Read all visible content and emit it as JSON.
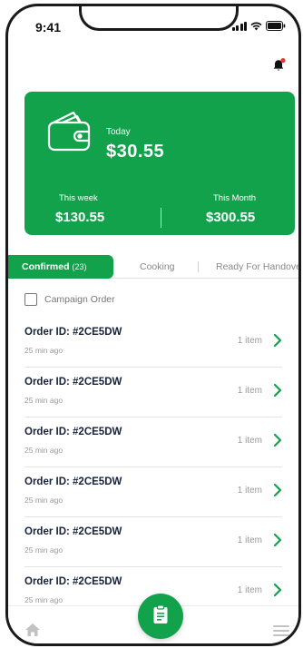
{
  "status_bar": {
    "time": "9:41"
  },
  "card": {
    "today_label": "Today",
    "today_value": "$30.55",
    "week_label": "This week",
    "week_value": "$130.55",
    "month_label": "This Month",
    "month_value": "$300.55",
    "color": "#12a24c"
  },
  "tabs": [
    {
      "label": "Confirmed",
      "count": "(23)",
      "active": true
    },
    {
      "label": "Cooking",
      "active": false
    },
    {
      "label": "Ready For Handover",
      "active": false
    }
  ],
  "campaign": {
    "label": "Campaign Order",
    "checked": false
  },
  "orders": [
    {
      "id": "Order ID: #2CE5DW",
      "time": "25 min ago",
      "count": "1 item"
    },
    {
      "id": "Order ID: #2CE5DW",
      "time": "25 min ago",
      "count": "1 item"
    },
    {
      "id": "Order ID: #2CE5DW",
      "time": "25 min ago",
      "count": "1 item"
    },
    {
      "id": "Order ID: #2CE5DW",
      "time": "25 min ago",
      "count": "1 item"
    },
    {
      "id": "Order ID: #2CE5DW",
      "time": "25 min ago",
      "count": "1 item"
    },
    {
      "id": "Order ID: #2CE5DW",
      "time": "25 min ago",
      "count": "1 item"
    }
  ],
  "icons": {
    "bell": "bell-icon",
    "wallet": "wallet-icon",
    "chevron": "chevron-right-icon",
    "home": "home-icon",
    "menu": "menu-icon",
    "fab": "clipboard-icon"
  },
  "colors": {
    "accent": "#12a24c",
    "notification_dot": "#e53935",
    "text_dark": "#16213a"
  }
}
